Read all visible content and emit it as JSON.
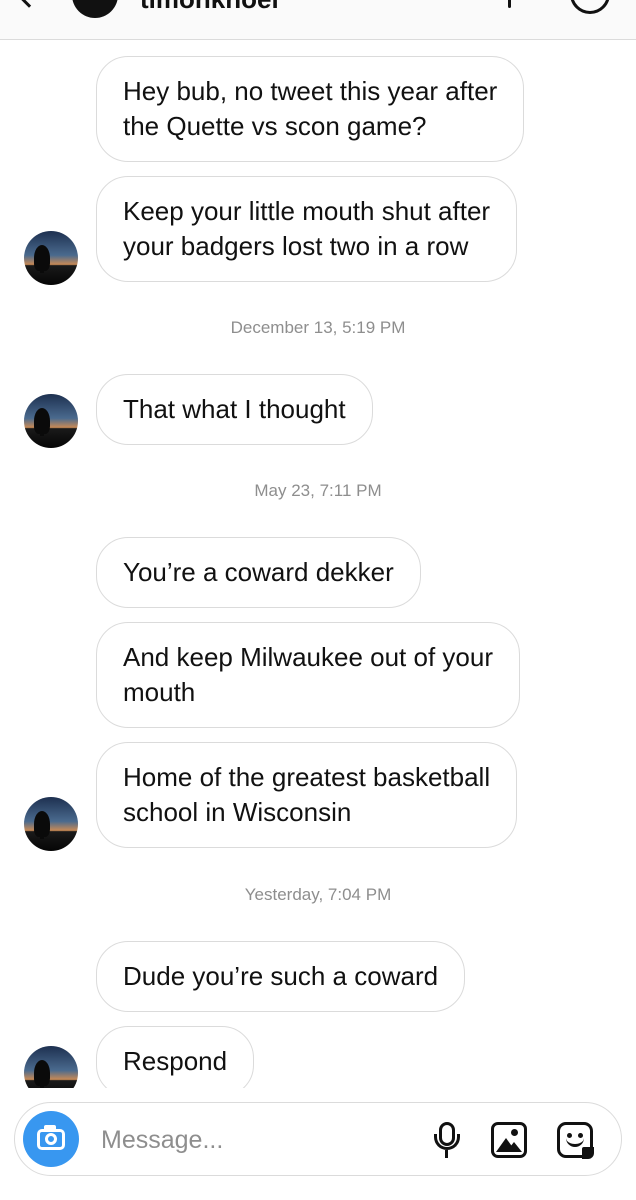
{
  "header": {
    "username": "timonkhoel"
  },
  "messages": [
    {
      "text": "Hey bub, no tweet this year after\nthe Quette vs scon game?",
      "sender": "me"
    },
    {
      "text": "Keep your little mouth shut after\nyour badgers lost two in a row",
      "sender": "them"
    },
    {
      "timestamp": "December 13, 5:19 PM"
    },
    {
      "text": "That what I thought",
      "sender": "them"
    },
    {
      "timestamp": "May 23, 7:11 PM"
    },
    {
      "text": "You’re a coward dekker",
      "sender": "them"
    },
    {
      "text": "And keep Milwaukee out of your\nmouth",
      "sender": "them"
    },
    {
      "text": "Home of the greatest basketball\nschool in Wisconsin",
      "sender": "them"
    },
    {
      "timestamp": "Yesterday, 7:04 PM"
    },
    {
      "text": "Dude you’re such a coward",
      "sender": "them"
    },
    {
      "text": "Respond",
      "sender": "them"
    }
  ],
  "composer": {
    "placeholder": "Message...",
    "camera_icon": "camera-icon",
    "mic_icon": "microphone-icon",
    "gallery_icon": "gallery-icon",
    "sticker_icon": "sticker-icon",
    "accent_color": "#3897f0"
  }
}
